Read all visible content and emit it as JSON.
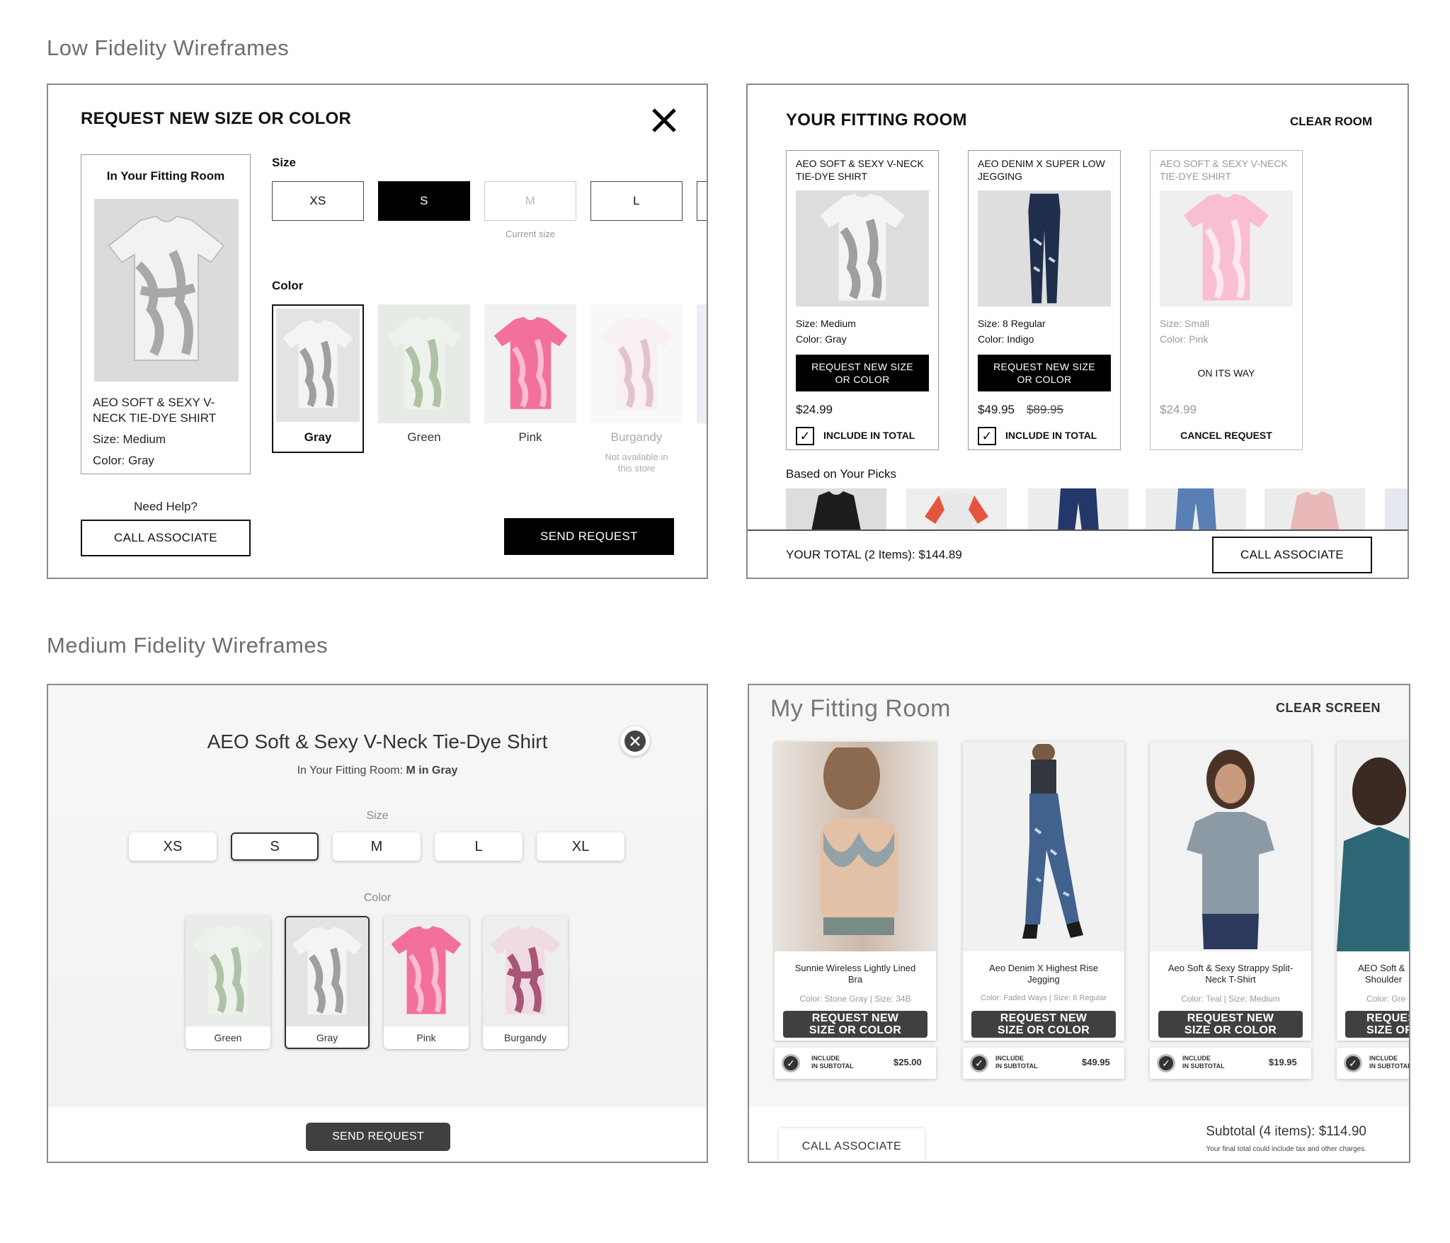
{
  "sections": {
    "low": "Low Fidelity Wireframes",
    "medium": "Medium Fidelity Wireframes"
  },
  "low_request": {
    "title": "REQUEST NEW SIZE OR COLOR",
    "panel_title": "In Your Fitting Room",
    "product_name_1": "AEO SOFT & SEXY V-",
    "product_name_2": "NECK TIE-DYE SHIRT",
    "size_line": "Size: Medium",
    "color_line": "Color: Gray",
    "size_label": "Size",
    "sizes": [
      "XS",
      "S",
      "M",
      "L"
    ],
    "current_size_note": "Current size",
    "color_label": "Color",
    "colors": [
      "Gray",
      "Green",
      "Pink",
      "Burgandy"
    ],
    "unavailable_1": "Not available in",
    "unavailable_2": "this store",
    "help_label": "Need Help?",
    "call_btn": "CALL ASSOCIATE",
    "send_btn": "SEND REQUEST"
  },
  "low_room": {
    "title": "YOUR FITTING ROOM",
    "clear": "CLEAR ROOM",
    "items": [
      {
        "name1": "AEO SOFT & SEXY V-NECK",
        "name2": "TIE-DYE SHIRT",
        "size": "Size: Medium",
        "color": "Color: Gray",
        "btn1": "REQUEST NEW SIZE",
        "btn2": "OR COLOR",
        "price": "$24.99",
        "include": "INCLUDE IN TOTAL"
      },
      {
        "name1": "AEO DENIM X SUPER LOW",
        "name2": "JEGGING",
        "size": "Size: 8 Regular",
        "color": "Color: Indigo",
        "btn1": "REQUEST NEW SIZE",
        "btn2": "OR COLOR",
        "price": "$49.95",
        "old_price": "$89.95",
        "include": "INCLUDE IN TOTAL"
      },
      {
        "name1": "AEO SOFT & SEXY V-NECK",
        "name2": "TIE-DYE SHIRT",
        "size": "Size: Small",
        "color": "Color: Pink",
        "status": "ON ITS WAY",
        "price": "$24.99",
        "cancel": "CANCEL REQUEST"
      }
    ],
    "picks_label": "Based on Your Picks",
    "total": "YOUR TOTAL (2 Items): $144.89",
    "call_btn": "CALL ASSOCIATE"
  },
  "med_request": {
    "title": "AEO Soft & Sexy V-Neck Tie-Dye Shirt",
    "subtitle_prefix": "In Your Fitting Room: ",
    "subtitle_value": "M in Gray",
    "size_label": "Size",
    "sizes": [
      "XS",
      "S",
      "M",
      "L",
      "XL"
    ],
    "color_label": "Color",
    "colors": [
      "Green",
      "Gray",
      "Pink",
      "Burgandy"
    ],
    "send_btn": "SEND REQUEST"
  },
  "med_room": {
    "title": "My Fitting Room",
    "clear": "CLEAR SCREEN",
    "items": [
      {
        "name1": "Sunnie Wireless Lightly Lined",
        "name2": "Bra",
        "meta": "Color: Stone Gray |  Size: 34B",
        "price": "$25.00"
      },
      {
        "name1": "Aeo Denim X Highest Rise",
        "name2": "Jegging",
        "meta": "Color: Faded Ways |  Size: 8 Regular",
        "price": "$49.95"
      },
      {
        "name1": "Aeo Soft & Sexy Strappy Split-",
        "name2": "Neck T-Shirt",
        "meta": "Color: Teal |  Size: Medium",
        "price": "$19.95"
      },
      {
        "name1": "AEO Soft &",
        "name2": "Shoulder",
        "meta": "Color: Gre",
        "price": ""
      }
    ],
    "request_btn1": "REQUEST NEW",
    "request_btn2": "SIZE OR COLOR",
    "include1": "INCLUDE",
    "include2": "IN SUBTOTAL",
    "call_btn": "CALL ASSOCIATE",
    "subtotal": "Subtotal (4 items): $114.90",
    "note": "Your final total could include tax and other charges."
  }
}
